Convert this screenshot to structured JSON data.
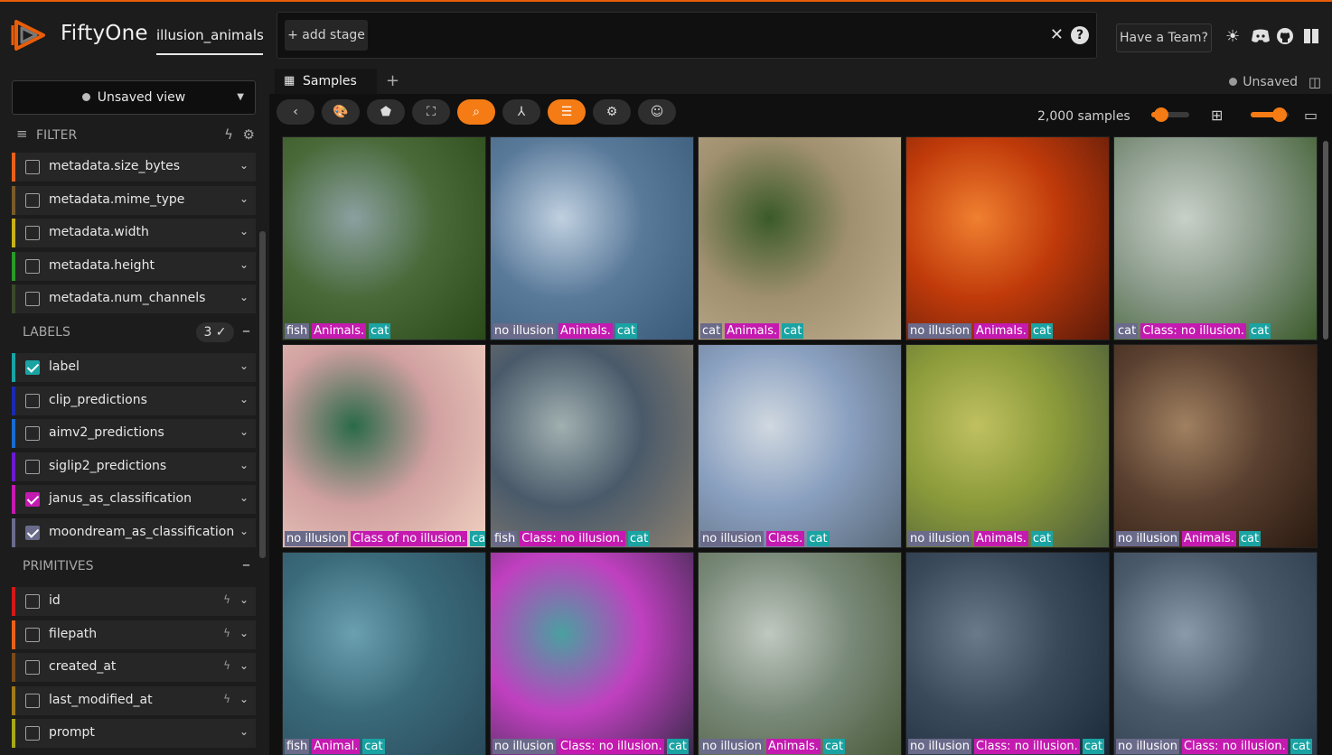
{
  "app": {
    "brand": "FiftyOne",
    "dataset": "illusion_animals"
  },
  "viewbar": {
    "add_stage": "+ add stage"
  },
  "header": {
    "team_button": "Have a Team?"
  },
  "sidebar": {
    "view_selector": "Unsaved view",
    "filter_title": "FILTER",
    "metadata_fields": [
      {
        "label": "metadata.size_bytes",
        "color": "#e8611a",
        "checked": false
      },
      {
        "label": "metadata.mime_type",
        "color": "#7a5a2a",
        "checked": false
      },
      {
        "label": "metadata.width",
        "color": "#c7b11a",
        "checked": false
      },
      {
        "label": "metadata.height",
        "color": "#2a9a2a",
        "checked": false
      },
      {
        "label": "metadata.num_channels",
        "color": "#3a4a2a",
        "checked": false
      }
    ],
    "labels_section": {
      "title": "LABELS",
      "count": "3 ✓",
      "collapse": "–"
    },
    "label_fields": [
      {
        "label": "label",
        "color": "#1aa3a3",
        "checked": true
      },
      {
        "label": "clip_predictions",
        "color": "#1a2ab0",
        "checked": false
      },
      {
        "label": "aimv2_predictions",
        "color": "#1a6ad0",
        "checked": false
      },
      {
        "label": "siglip2_predictions",
        "color": "#6a1ad0",
        "checked": false
      },
      {
        "label": "janus_as_classification",
        "color": "#c41ab0",
        "checked": true
      },
      {
        "label": "moondream_as_classification",
        "color": "#6a6a8a",
        "checked": true
      }
    ],
    "primitives_section": {
      "title": "PRIMITIVES",
      "collapse": "–"
    },
    "primitive_fields": [
      {
        "label": "id",
        "color": "#d01a1a",
        "checked": false,
        "bolt": true
      },
      {
        "label": "filepath",
        "color": "#e8611a",
        "checked": false,
        "bolt": true
      },
      {
        "label": "created_at",
        "color": "#7a4a1a",
        "checked": false,
        "bolt": true
      },
      {
        "label": "last_modified_at",
        "color": "#a07a1a",
        "checked": false,
        "bolt": true
      },
      {
        "label": "prompt",
        "color": "#a8a81a",
        "checked": false,
        "bolt": false
      }
    ]
  },
  "main": {
    "tab_label": "Samples",
    "tab_add": "+",
    "unsaved_label": "Unsaved",
    "sample_count": "2,000 samples",
    "zoom_slider": 0.25,
    "size_slider": 0.75
  },
  "colors": {
    "accent": "#f57b14",
    "tag_label": "#1aa3a3",
    "tag_janus": "#c41ab0",
    "tag_moondream": "#6a6a8a"
  },
  "samples": [
    {
      "moondream": "fish",
      "janus": "Animals.",
      "label": "cat"
    },
    {
      "moondream": "no illusion",
      "janus": "Animals.",
      "label": "cat"
    },
    {
      "moondream": "cat",
      "janus": "Animals.",
      "label": "cat"
    },
    {
      "moondream": "no illusion",
      "janus": "Animals.",
      "label": "cat"
    },
    {
      "moondream": "cat",
      "janus": "Class: no illusion.",
      "label": "cat"
    },
    {
      "moondream": "no illusion",
      "janus": "Class of no illusion.",
      "label": "cat"
    },
    {
      "moondream": "fish",
      "janus": "Class: no illusion.",
      "label": "cat"
    },
    {
      "moondream": "no illusion",
      "janus": "Class.",
      "label": "cat"
    },
    {
      "moondream": "no illusion",
      "janus": "Animals.",
      "label": "cat"
    },
    {
      "moondream": "no illusion",
      "janus": "Animals.",
      "label": "cat"
    },
    {
      "moondream": "fish",
      "janus": "Animal.",
      "label": "cat"
    },
    {
      "moondream": "no illusion",
      "janus": "Class: no illusion.",
      "label": "cat"
    },
    {
      "moondream": "no illusion",
      "janus": "Animals.",
      "label": "cat"
    },
    {
      "moondream": "no illusion",
      "janus": "Class: no illusion.",
      "label": "cat"
    },
    {
      "moondream": "no illusion",
      "janus": "Class: no illusion.",
      "label": "cat"
    }
  ]
}
